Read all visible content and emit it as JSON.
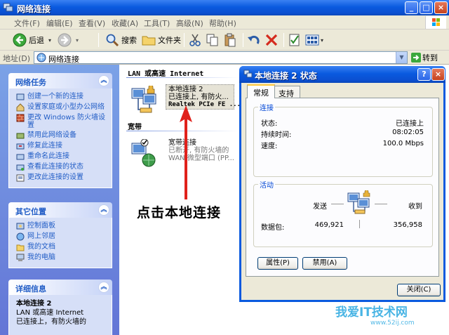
{
  "window": {
    "title": "网络连接"
  },
  "menu": [
    "文件(F)",
    "编辑(E)",
    "查看(V)",
    "收藏(A)",
    "工具(T)",
    "高级(N)",
    "帮助(H)"
  ],
  "toolbar": {
    "back": "后退",
    "search": "搜索",
    "folders": "文件夹"
  },
  "address": {
    "label": "地址(D)",
    "value": "网络连接",
    "go": "转到"
  },
  "tasks": {
    "network": {
      "title": "网络任务",
      "items": [
        "创建一个新的连接",
        "设置家庭或小型办公网络",
        "更改 Windows 防火墙设置",
        "禁用此网络设备",
        "修复此连接",
        "重命名此连接",
        "查看此连接的状态",
        "更改此连接的设置"
      ]
    },
    "other": {
      "title": "其它位置",
      "items": [
        "控制面板",
        "网上邻居",
        "我的文档",
        "我的电脑"
      ]
    },
    "details": {
      "title": "详细信息",
      "name": "本地连接 2",
      "type": "LAN 或高速 Internet",
      "status": "已连接上，有防火墙的"
    }
  },
  "content": {
    "group_lan": "LAN 或高速 Internet",
    "group_broadband": "宽带",
    "lan_conn": {
      "name": "本地连接 2",
      "status": "已连接上, 有防火...",
      "device": "Realtek PCIe FE ..."
    },
    "bb_conn": {
      "name": "宽带连接",
      "status": "已断开, 有防火墙的",
      "device": "WAN 微型端口 (PP..."
    }
  },
  "annotation": "点击本地连接",
  "dialog": {
    "title": "本地连接 2 状态",
    "tabs": [
      "常规",
      "支持"
    ],
    "connection": {
      "legend": "连接",
      "status_label": "状态:",
      "status": "已连接上",
      "duration_label": "持续时间:",
      "duration": "08:02:05",
      "speed_label": "速度:",
      "speed": "100.0 Mbps"
    },
    "activity": {
      "legend": "活动",
      "sent": "发送",
      "received": "收到",
      "packets_label": "数据包:",
      "packets_sent": "469,921",
      "packets_received": "356,958"
    },
    "buttons": {
      "properties": "属性(P)",
      "disable": "禁用(A)",
      "close": "关闭(C)"
    }
  },
  "watermark": {
    "text": "我爱IT技术网",
    "url": "www.52ij.com"
  }
}
